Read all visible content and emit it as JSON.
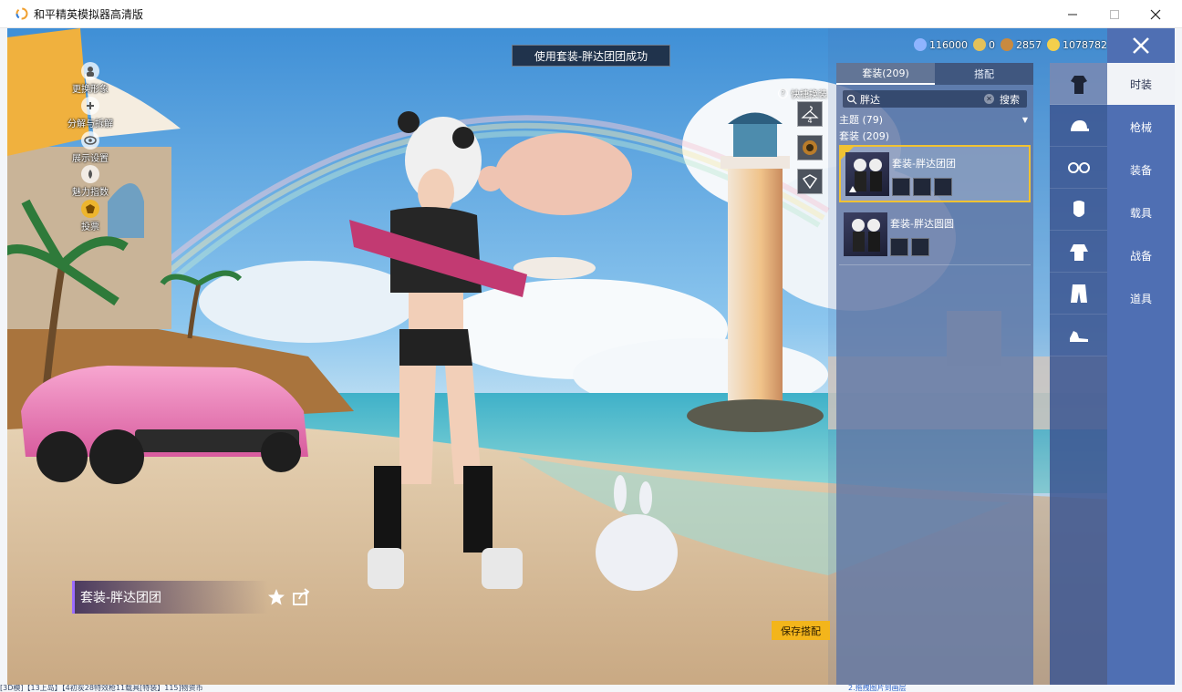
{
  "window": {
    "title": "和平精英模拟器高清版"
  },
  "desktop": {
    "bottom_text": "[3D模]【13上岛】【4初炭28特效枪11载具[特装】115]物资币",
    "bottom_link": "2.拖拽图片到画层"
  },
  "left_menu": [
    {
      "label": "更换形象",
      "icon": "person-icon"
    },
    {
      "label": "分解与拆解",
      "icon": "split-icon"
    },
    {
      "label": "展示设置",
      "icon": "eye-icon"
    },
    {
      "label": "魅力指数",
      "icon": "charm-icon"
    },
    {
      "label": "投票",
      "icon": "badge-icon"
    }
  ],
  "notice": "使用套装-胖达团团成功",
  "quick_change": {
    "label": "快捷换装",
    "slot_number": "4"
  },
  "currency": [
    {
      "value": "116000",
      "color": "#8fb4ff"
    },
    {
      "value": "0",
      "color": "#e3c15a"
    },
    {
      "value": "2857",
      "color": "#c98a3f"
    },
    {
      "value": "1078782",
      "color": "#f3cf4c"
    }
  ],
  "panel": {
    "tabs": [
      {
        "label": "套装(209)",
        "active": true
      },
      {
        "label": "搭配",
        "active": false
      }
    ],
    "search": {
      "value": "胖达",
      "button": "搜索"
    },
    "theme_label": "主题 (79)",
    "suit_count": "套装 (209)",
    "suits": [
      {
        "name": "套装-胖达团团",
        "selected": true,
        "parts": 3
      },
      {
        "name": "套装-胖达圆圆",
        "selected": false,
        "parts": 2
      }
    ]
  },
  "category_icons": [
    "outfit-icon",
    "hat-icon",
    "glasses-icon",
    "mask-icon",
    "top-icon",
    "pants-icon",
    "shoes-icon"
  ],
  "categories": [
    {
      "label": "时装",
      "active": true
    },
    {
      "label": "枪械",
      "active": false
    },
    {
      "label": "装备",
      "active": false
    },
    {
      "label": "载具",
      "active": false
    },
    {
      "label": "战备",
      "active": false
    },
    {
      "label": "道具",
      "active": false
    }
  ],
  "save_button": "保存搭配",
  "selected_item_name": "套装-胖达团团",
  "colors": {
    "panel_blue": "#4f6fb3",
    "accent_gold": "#f3b51b",
    "name_purple": "#9b6cff"
  }
}
